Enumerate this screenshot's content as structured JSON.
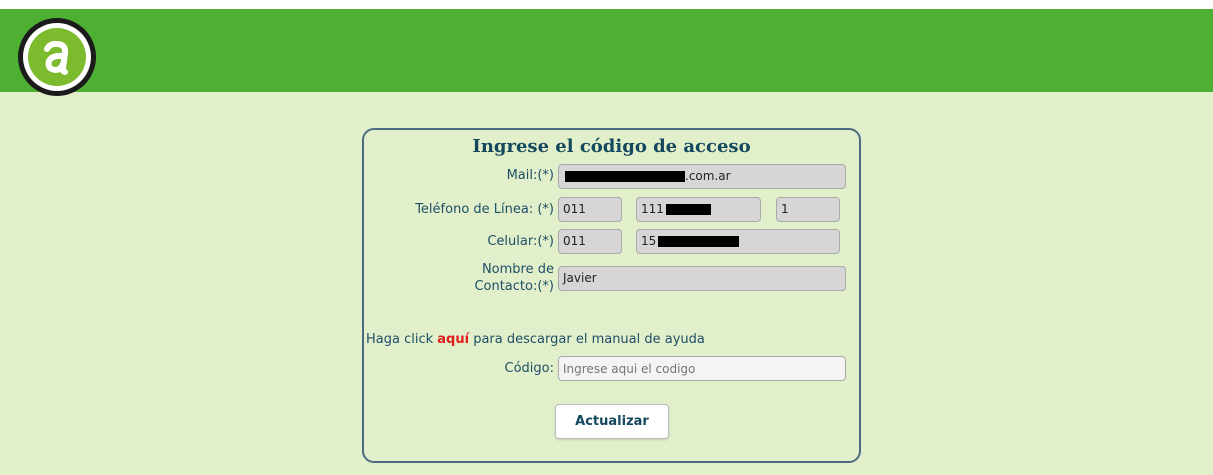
{
  "logo": {
    "letter": "a",
    "icon": "a-letter-logo-icon"
  },
  "form": {
    "title": "Ingrese el código de acceso",
    "mail_label": "Mail:(*)",
    "mail_suffix": ".com.ar",
    "telefono_label": "Teléfono de Línea: (*)",
    "telefono_area": "011",
    "telefono_prefix": "111",
    "telefono_ext": "1",
    "celular_label": "Celular:(*)",
    "celular_area": "011",
    "celular_prefix": "15",
    "contacto_label_line1": "Nombre de",
    "contacto_label_line2": "Contacto:(*)",
    "contacto_value": "Javier",
    "help_prefix": "Haga click ",
    "help_link": "aquí",
    "help_suffix": " para descargar el manual de ayuda",
    "codigo_label": "Código:",
    "codigo_placeholder": "Ingrese aqui el codigo",
    "submit_label": "Actualizar"
  },
  "colors": {
    "header_green": "#4db033",
    "page_background": "#e2efcb",
    "link_red": "#e01e1e",
    "title_blue": "#14485e"
  }
}
